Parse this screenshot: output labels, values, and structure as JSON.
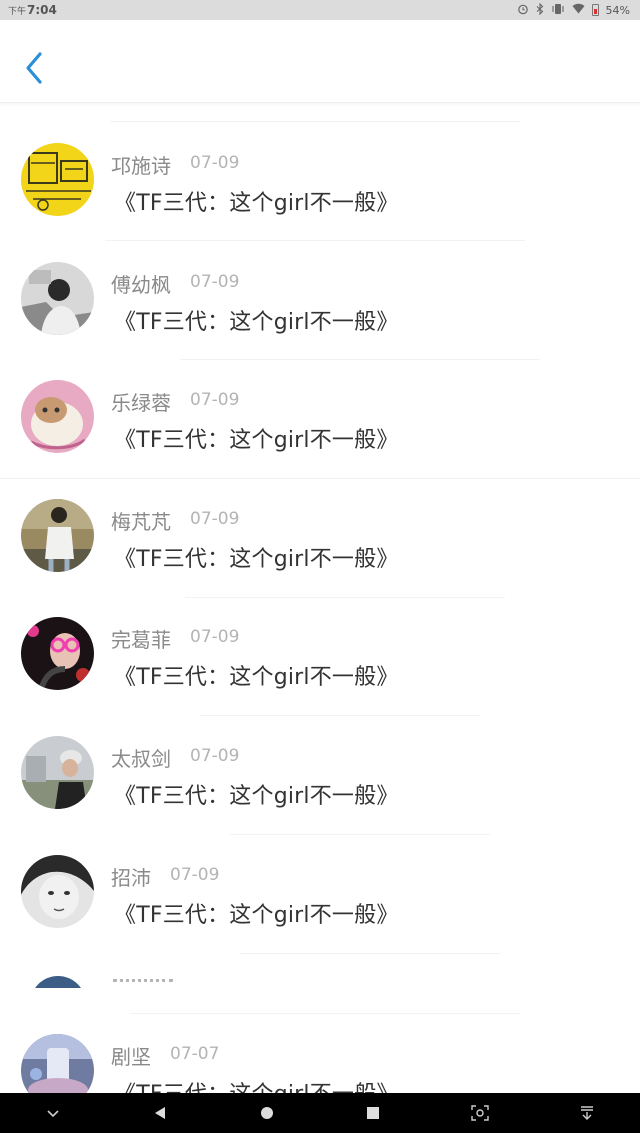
{
  "status_bar": {
    "period": "下午",
    "time": "7:04",
    "battery": "54%"
  },
  "colors": {
    "accent": "#2a8fd8",
    "name": "#8a8a8a",
    "date": "#b4b4b4",
    "message": "#333333"
  },
  "list": {
    "items": [
      {
        "name": "邛施诗",
        "date": "07-09",
        "message": "《TF三代：这个girl不一般》"
      },
      {
        "name": "傅幼枫",
        "date": "07-09",
        "message": "《TF三代：这个girl不一般》"
      },
      {
        "name": "乐绿蓉",
        "date": "07-09",
        "message": "《TF三代：这个girl不一般》"
      },
      {
        "name": "梅芃芃",
        "date": "07-09",
        "message": "《TF三代：这个girl不一般》"
      },
      {
        "name": "完葛菲",
        "date": "07-09",
        "message": "《TF三代：这个girl不一般》"
      },
      {
        "name": "太叔剑",
        "date": "07-09",
        "message": "《TF三代：这个girl不一般》"
      },
      {
        "name": "招沛",
        "date": "07-09",
        "message": "《TF三代：这个girl不一般》"
      },
      {
        "name": "剧坚",
        "date": "07-07",
        "message": "《TF三代：这个girl不一般》"
      }
    ]
  },
  "nav_bar": {
    "icons": [
      "chevron-down-icon",
      "back-triangle-icon",
      "home-circle-icon",
      "recents-square-icon",
      "screenshot-icon",
      "pull-down-icon"
    ]
  }
}
